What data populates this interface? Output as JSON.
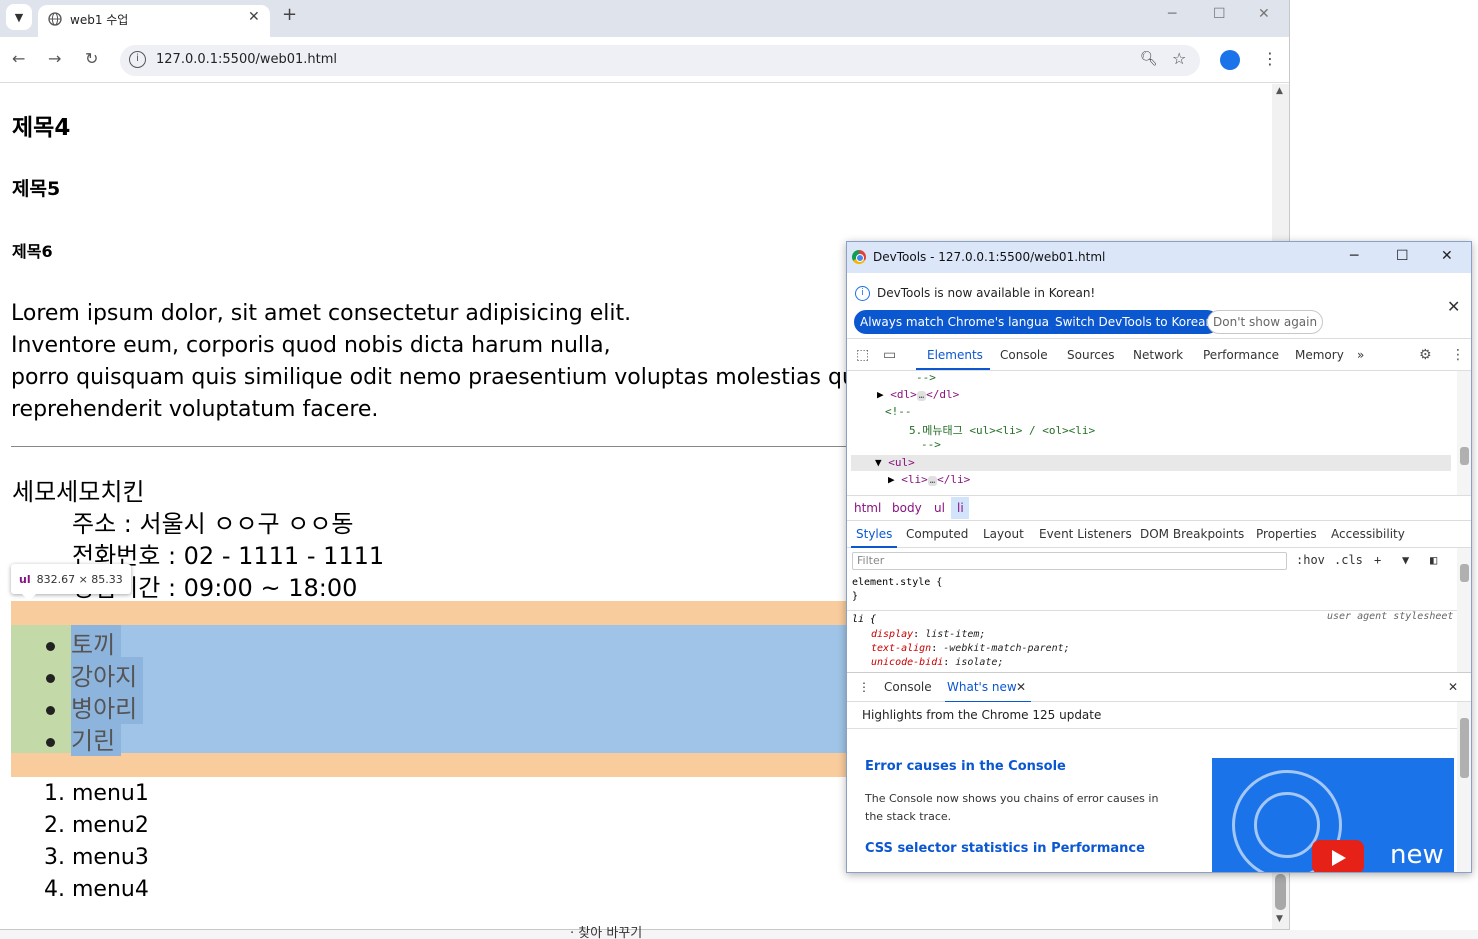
{
  "browser": {
    "tab_title": "web1 수업",
    "tab_close": "✕",
    "new_tab": "+",
    "url": "127.0.0.1:5500/web01.html"
  },
  "page": {
    "h4": "제목4",
    "h5": "제목5",
    "h6": "제목6",
    "paragraph_lines": [
      "Lorem ipsum dolor, sit amet consectetur adipisicing elit.",
      "Inventore eum, corporis quod nobis dicta harum nulla,",
      "porro quisquam quis similique odit nemo praesentium voluptas molestias qu",
      "reprehenderit voluptatum facere."
    ],
    "shop_name": "세모세모치킨",
    "shop_address": "주소 : 서울시 ㅇㅇ구 ㅇㅇ동",
    "shop_phone": "전화번호 : 02 - 1111 - 1111",
    "shop_hours": "영업시간 : 09:00 ~ 18:00",
    "tooltip": {
      "tag": "ul",
      "size": "832.67 × 85.33"
    },
    "ul_items": [
      "토끼",
      "강아지",
      "병아리",
      "기린"
    ],
    "ol_items": [
      "1. menu1",
      "2. menu2",
      "3. menu3",
      "4. menu4"
    ],
    "taskbar_text": "· 찾아 바꾸기"
  },
  "devtools": {
    "window_title": "DevTools - 127.0.0.1:5500/web01.html",
    "info_message": "DevTools is now available in Korean!",
    "btn_match": "Always match Chrome's language",
    "btn_switch": "Switch DevTools to Korean",
    "btn_dont_show": "Don't show again",
    "tabs": [
      "Elements",
      "Console",
      "Sources",
      "Network",
      "Performance",
      "Memory"
    ],
    "tab_more": "»",
    "dom_lines": {
      "l1": "-->",
      "l2_tag_open": "<dl>",
      "l2_tag_close": "</dl>",
      "l3": "<!--",
      "l4": "5.메뉴태그 <ul><li> / <ol><li>",
      "l5": "-->",
      "l6": "<ul>",
      "l7_open": "<li>",
      "l7_close": "</li>",
      "ellipsis": "…"
    },
    "breadcrumbs": [
      "html",
      "body",
      "ul",
      "li"
    ],
    "subtabs": [
      "Styles",
      "Computed",
      "Layout",
      "Event Listeners",
      "DOM Breakpoints",
      "Properties",
      "Accessibility"
    ],
    "filter_placeholder": "Filter",
    "hov": ":hov",
    "cls": ".cls",
    "styles": {
      "element_style": "element.style {",
      "close_brace": "}",
      "li_selector": "li {",
      "ua_label": "user agent stylesheet",
      "props": [
        {
          "name": "display",
          "value": "list-item;"
        },
        {
          "name": "text-align",
          "value": "-webkit-match-parent;"
        },
        {
          "name": "unicode-bidi",
          "value": "isolate;"
        }
      ]
    },
    "drawer_tabs": [
      "Console",
      "What's new"
    ],
    "whats_new": {
      "heading": "Highlights from the Chrome 125 update",
      "item1_title": "Error causes in the Console",
      "item1_body": "The Console now shows you chains of error causes in the stack trace.",
      "item2_title": "CSS selector statistics in Performance",
      "image_word": "new"
    }
  }
}
